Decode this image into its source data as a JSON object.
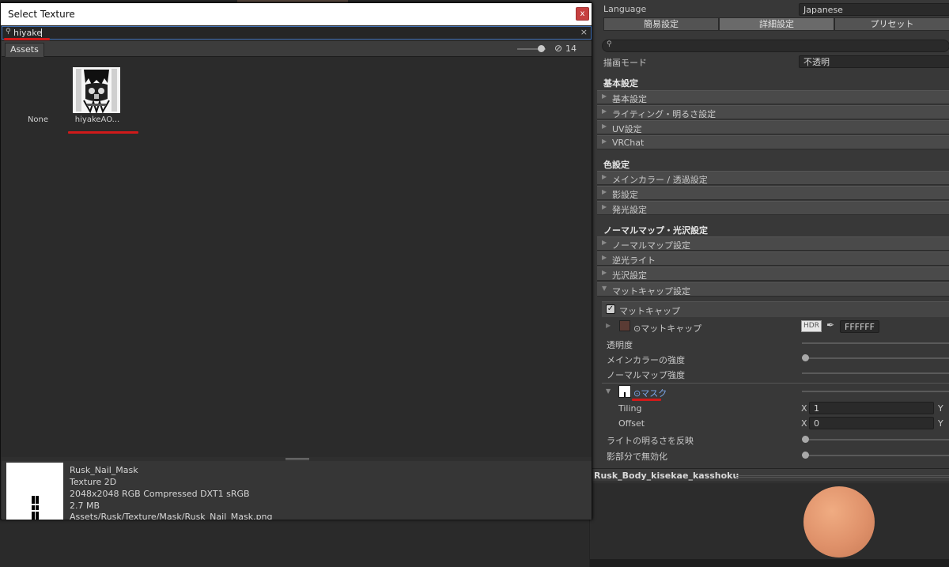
{
  "dialog": {
    "title": "Select Texture",
    "close_glyph": "x",
    "search": {
      "value": "hiyake",
      "clear_glyph": "×"
    },
    "tab_label": "Assets",
    "hidden_count": "14",
    "items": [
      {
        "label": "None"
      },
      {
        "label": "hiyakeAO..."
      }
    ],
    "info": {
      "name": "Rusk_Nail_Mask",
      "type": "Texture 2D",
      "format": "2048x2048  RGB Compressed DXT1 sRGB",
      "size": "2.7 MB",
      "path": "Assets/Rusk/Texture/Mask/Rusk_Nail_Mask.png"
    }
  },
  "inspector": {
    "language": {
      "label": "Language",
      "value": "Japanese"
    },
    "tabs": [
      "簡易設定",
      "詳細設定",
      "プリセット"
    ],
    "active_tab": "詳細設定",
    "render_mode": {
      "label": "描画モード",
      "value": "不透明"
    },
    "groups": [
      {
        "header": "基本設定",
        "folds": [
          "基本設定",
          "ライティング・明るさ設定",
          "UV設定",
          "VRChat"
        ]
      },
      {
        "header": "色設定",
        "folds": [
          "メインカラー / 透過設定",
          "影設定",
          "発光設定"
        ]
      },
      {
        "header": "ノーマルマップ・光沢設定",
        "folds": [
          "ノーマルマップ設定",
          "逆光ライト",
          "光沢設定",
          "マットキャップ設定"
        ]
      }
    ],
    "matcap": {
      "toggle_label": "マットキャップ",
      "color_label": "⊙マットキャップ",
      "hdr_label": "HDR",
      "hex_value": "FFFFFF",
      "rows": [
        "透明度",
        "メインカラーの強度",
        "ノーマルマップ強度"
      ],
      "mask_label": "⊙マスク",
      "tiling": {
        "label": "Tiling",
        "x_axis": "X",
        "x_value": "1",
        "y_axis": "Y"
      },
      "offset": {
        "label": "Offset",
        "x_axis": "X",
        "x_value": "0",
        "y_axis": "Y"
      },
      "bottom_rows": [
        "ライトの明るさを反映",
        "影部分で無効化"
      ]
    },
    "preview_title": "Rusk_Body_kisekae_kasshoku"
  },
  "colors": {
    "accent_underline": "#d11a1a",
    "matcap_swatch": "#5a3b34",
    "sphere": "#e19370",
    "close_button": "#c64040"
  }
}
